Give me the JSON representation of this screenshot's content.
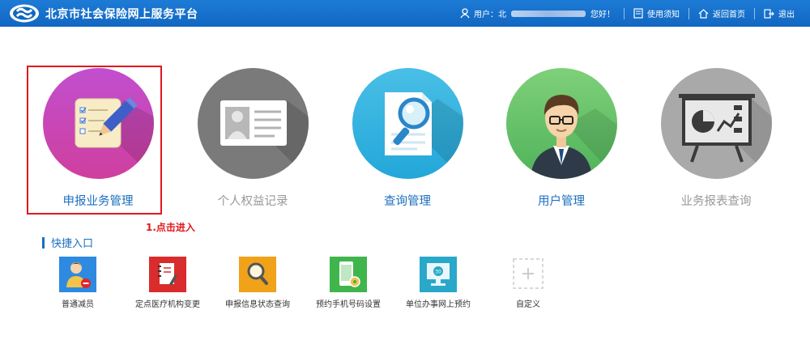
{
  "header": {
    "site_title": "北京市社会保险网上服务平台",
    "user_prefix": "用户：北",
    "user_suffix": "您好！",
    "usage_notice": "使用须知",
    "home": "返回首页",
    "logout": "退出"
  },
  "modules": [
    {
      "label": "申报业务管理",
      "color": "#1b6fbf"
    },
    {
      "label": "个人权益记录",
      "color": "#999999"
    },
    {
      "label": "查询管理",
      "color": "#1b6fbf"
    },
    {
      "label": "用户管理",
      "color": "#1b6fbf"
    },
    {
      "label": "业务报表查询",
      "color": "#999999"
    }
  ],
  "annotation": {
    "hint": "1.点击进入",
    "color": "#e0191c"
  },
  "quick_entry": {
    "title": "快捷入口",
    "items": [
      {
        "label": "普通减员",
        "icon": "user-minus-icon"
      },
      {
        "label": "定点医疗机构变更",
        "icon": "notebook-edit-icon"
      },
      {
        "label": "申报信息状态查询",
        "icon": "search-icon"
      },
      {
        "label": "预约手机号码设置",
        "icon": "phone-settings-icon"
      },
      {
        "label": "单位办事网上预约",
        "icon": "calendar-monitor-icon"
      },
      {
        "label": "自定义",
        "icon": "plus-icon"
      }
    ]
  }
}
